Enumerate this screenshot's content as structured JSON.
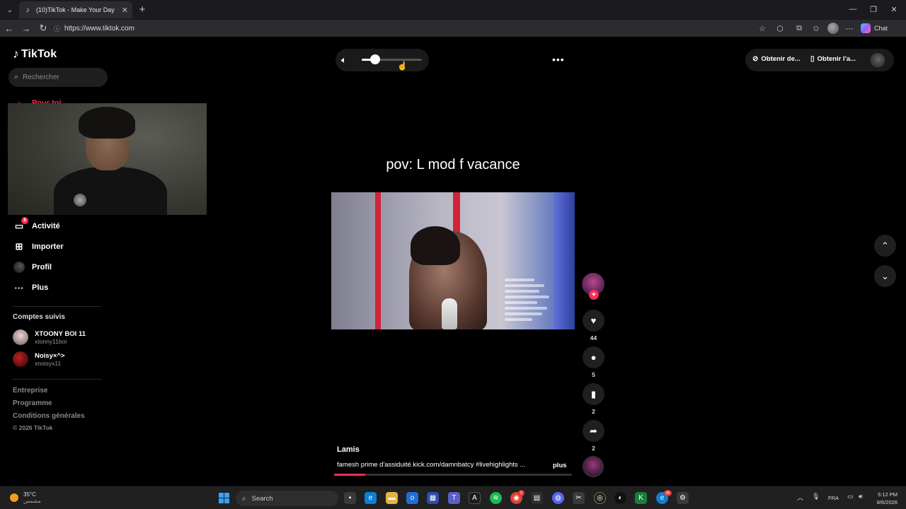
{
  "browser": {
    "tab_title": "(10)TikTok - Make Your Day",
    "url": "https://www.tiktok.com",
    "chat_label": "Chat"
  },
  "sidebar": {
    "logo": "TikTok",
    "search_placeholder": "Rechercher",
    "nav": {
      "foryou": "Pour toi",
      "activity": "Activité",
      "activity_badge": "8",
      "upload": "Importer",
      "profile": "Profil",
      "more": "Plus"
    },
    "following_title": "Comptes suivis",
    "following": [
      {
        "name": "XTOONY BOI 11",
        "handle": "xtonny11boi"
      },
      {
        "name": "Noisy×^>",
        "handle": "xnoisyx11"
      }
    ],
    "footer": [
      "Entreprise",
      "Programme",
      "Conditions générales"
    ],
    "copyright": "© 2026 TikTok"
  },
  "player": {
    "volume": 0.22,
    "more_label": "•••"
  },
  "header": {
    "get_coins": "Obtenir de...",
    "get_app": "Obtenir l'a..."
  },
  "video": {
    "caption": "pov: L mod f vacance",
    "author": "Lamis",
    "description": "famesh prime d'assiduité.kick.com/damnbatcy #livehighlights ...",
    "more": "plus",
    "progress": 0.13,
    "likes": "44",
    "comments": "5",
    "saves": "2",
    "shares": "2"
  },
  "taskbar": {
    "temperature": "35°C",
    "weather_text": "مشمس",
    "search": "Search",
    "lang": "FRA",
    "time": "5:12 PM",
    "date": "8/6/2026",
    "spotify_badge": "",
    "discord_badge": "",
    "chrome_badge": "",
    "badge_red": "5",
    "badge_99": "99"
  }
}
